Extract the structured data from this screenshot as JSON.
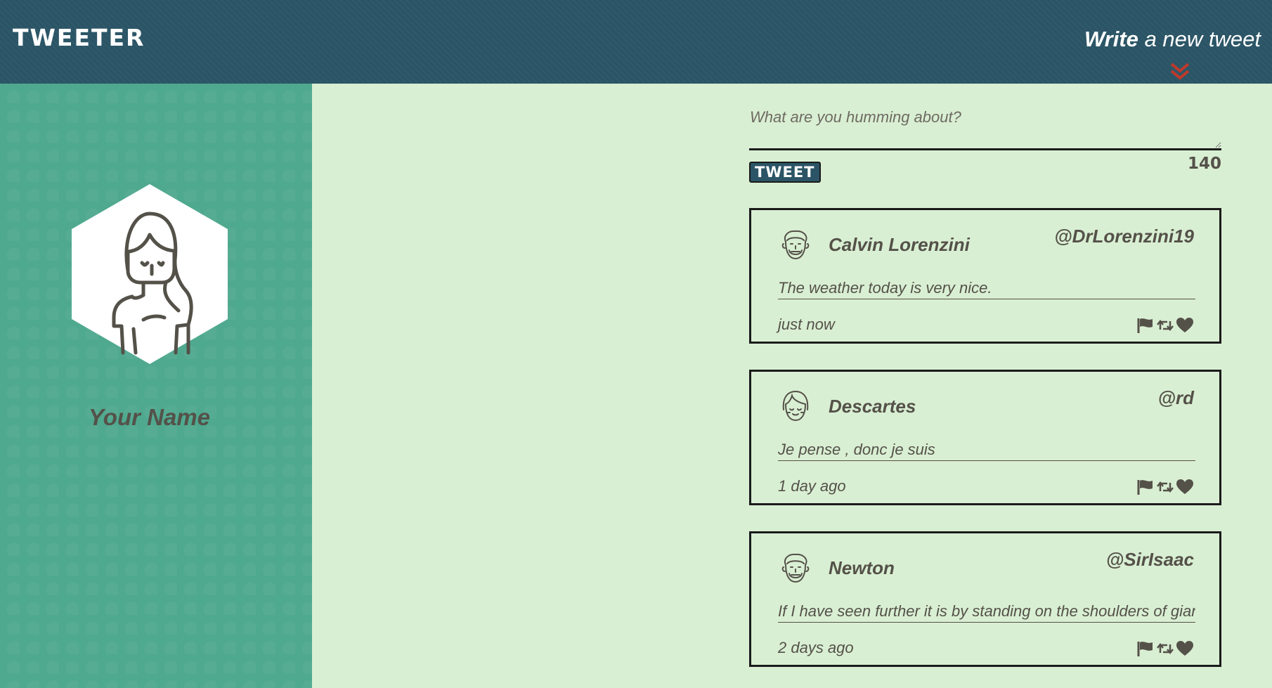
{
  "header": {
    "brand": "TWEETER",
    "compose_toggle_bold": "Write",
    "compose_toggle_rest": "a new tweet",
    "toggle_icon": "double-chevron-down-icon"
  },
  "profile": {
    "name": "Your Name",
    "avatar_icon": "woman-avatar-icon"
  },
  "compose": {
    "placeholder": "What are you humming about?",
    "value": "",
    "button_label": "TWEET",
    "counter": "140"
  },
  "tweets": [
    {
      "name": "Calvin Lorenzini",
      "handle": "@DrLorenzini19",
      "text": "The weather today is very nice.",
      "time": "just now",
      "avatar_icon": "curly-hair-avatar-icon"
    },
    {
      "name": "Descartes",
      "handle": "@rd",
      "text": "Je pense , donc je suis",
      "time": "1 day ago",
      "avatar_icon": "bangs-avatar-icon"
    },
    {
      "name": "Newton",
      "handle": "@SirIsaac",
      "text": "If I have seen further it is by standing on the shoulders of giants",
      "time": "2 days ago",
      "avatar_icon": "curly-hair-avatar-icon"
    }
  ],
  "tweet_actions": [
    "flag-icon",
    "retweet-icon",
    "heart-icon"
  ],
  "colors": {
    "nav": "#2b5566",
    "sidebar": "#4fa98f",
    "page": "#d9efd3",
    "text": "#545149",
    "accent_chevron": "#c0392b"
  }
}
